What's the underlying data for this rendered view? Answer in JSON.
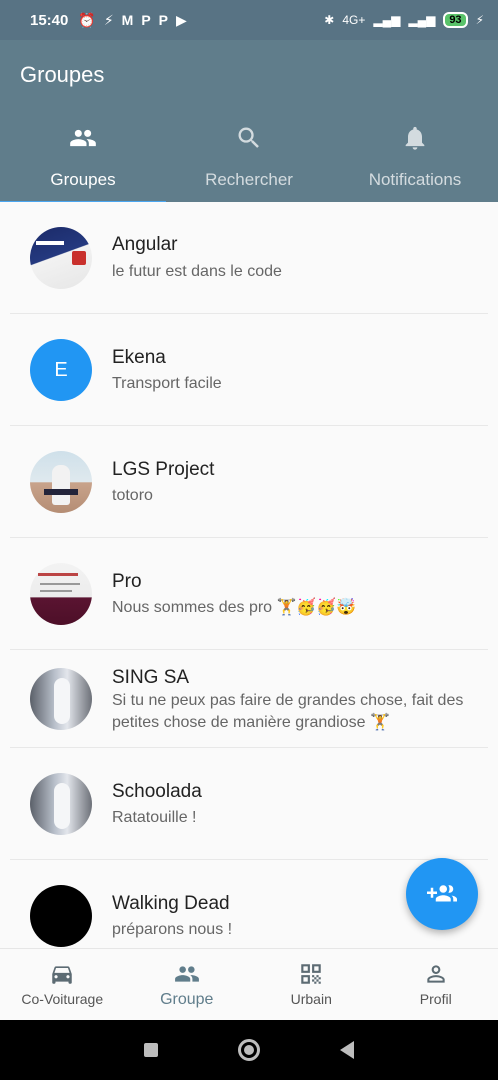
{
  "status_bar": {
    "time": "15:40",
    "network": "4G+",
    "battery": "93",
    "icons_left": [
      "alarm-icon",
      "messenger-icon",
      "gmail-icon",
      "p-icon",
      "p-icon",
      "youtube-icon"
    ],
    "icons_right": [
      "bluetooth-icon",
      "signal-icon",
      "signal-icon",
      "battery-icon",
      "charging-icon"
    ]
  },
  "app_bar": {
    "title": "Groupes",
    "tabs": [
      {
        "label": "Groupes",
        "icon": "people-icon",
        "active": true
      },
      {
        "label": "Rechercher",
        "icon": "search-icon",
        "active": false
      },
      {
        "label": "Notifications",
        "icon": "bell-icon",
        "active": false
      }
    ]
  },
  "groups": [
    {
      "name": "Angular",
      "description": "le futur est dans le code",
      "avatar": "image"
    },
    {
      "name": "Ekena",
      "description": "Transport facile",
      "avatar": "letter",
      "avatar_letter": "E",
      "avatar_color": "#2196f3"
    },
    {
      "name": "LGS Project",
      "description": "totoro",
      "avatar": "image"
    },
    {
      "name": "Pro",
      "description": "Nous sommes des pro 🏋️🥳🥳🤯",
      "avatar": "image"
    },
    {
      "name": "SING SA",
      "description": "Si tu ne peux pas faire de grandes chose, fait des petites chose de manière grandiose 🏋️",
      "avatar": "image"
    },
    {
      "name": "Schoolada",
      "description": "Ratatouille !",
      "avatar": "image"
    },
    {
      "name": "Walking Dead",
      "description": "préparons nous !",
      "avatar": "image"
    }
  ],
  "fab": {
    "icon": "group-add-icon"
  },
  "bottom_nav": [
    {
      "label": "Co-Voiturage",
      "icon": "car-icon",
      "active": false
    },
    {
      "label": "Groupe",
      "icon": "people-icon",
      "active": true
    },
    {
      "label": "Urbain",
      "icon": "qr-code-icon",
      "active": false
    },
    {
      "label": "Profil",
      "icon": "person-icon",
      "active": false
    }
  ],
  "colors": {
    "app_bar": "#607d8b",
    "status_bar": "#587384",
    "accent": "#2196f3",
    "tab_indicator": "#4aa6f0"
  }
}
